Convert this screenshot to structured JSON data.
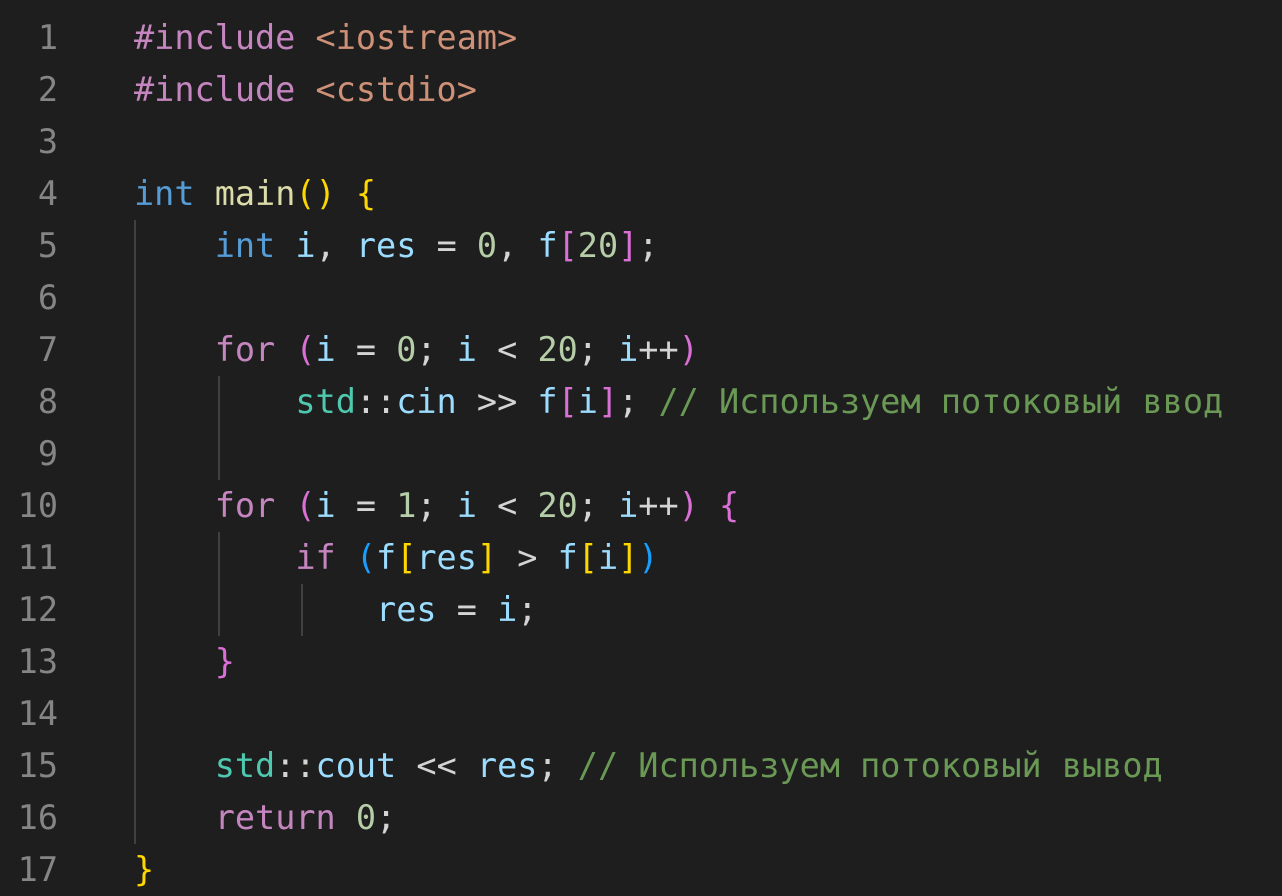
{
  "editor": {
    "colors": {
      "background": "#1e1e1e",
      "line_number": "#858585",
      "directive": "#c586c0",
      "header": "#ce9178",
      "keyword": "#569cd6",
      "control": "#c586c0",
      "function": "#dcdcaa",
      "variable": "#9cdcfe",
      "number": "#b5cea8",
      "namespace": "#4ec9b0",
      "comment": "#6a9955",
      "bracket_level1": "#ffd700",
      "bracket_level2": "#da70d6",
      "bracket_level3": "#179fff"
    },
    "lines": [
      {
        "num": "1",
        "tokens": [
          {
            "t": "#include",
            "c": "dir"
          },
          {
            "t": " ",
            "c": "plain"
          },
          {
            "t": "<iostream>",
            "c": "hdr"
          }
        ]
      },
      {
        "num": "2",
        "tokens": [
          {
            "t": "#include",
            "c": "dir"
          },
          {
            "t": " ",
            "c": "plain"
          },
          {
            "t": "<cstdio>",
            "c": "hdr"
          }
        ]
      },
      {
        "num": "3",
        "tokens": []
      },
      {
        "num": "4",
        "tokens": [
          {
            "t": "int",
            "c": "kw"
          },
          {
            "t": " ",
            "c": "plain"
          },
          {
            "t": "main",
            "c": "fn"
          },
          {
            "t": "()",
            "c": "b1"
          },
          {
            "t": " ",
            "c": "plain"
          },
          {
            "t": "{",
            "c": "b1"
          }
        ]
      },
      {
        "num": "5",
        "tokens": [
          {
            "t": "    ",
            "c": "plain"
          },
          {
            "t": "int",
            "c": "kw"
          },
          {
            "t": " ",
            "c": "plain"
          },
          {
            "t": "i",
            "c": "var"
          },
          {
            "t": ", ",
            "c": "op"
          },
          {
            "t": "res",
            "c": "var"
          },
          {
            "t": " = ",
            "c": "op"
          },
          {
            "t": "0",
            "c": "num"
          },
          {
            "t": ", ",
            "c": "op"
          },
          {
            "t": "f",
            "c": "var"
          },
          {
            "t": "[",
            "c": "b2"
          },
          {
            "t": "20",
            "c": "num"
          },
          {
            "t": "]",
            "c": "b2"
          },
          {
            "t": ";",
            "c": "op"
          }
        ]
      },
      {
        "num": "6",
        "tokens": []
      },
      {
        "num": "7",
        "tokens": [
          {
            "t": "    ",
            "c": "plain"
          },
          {
            "t": "for",
            "c": "ctrl"
          },
          {
            "t": " ",
            "c": "plain"
          },
          {
            "t": "(",
            "c": "b2"
          },
          {
            "t": "i",
            "c": "var"
          },
          {
            "t": " = ",
            "c": "op"
          },
          {
            "t": "0",
            "c": "num"
          },
          {
            "t": "; ",
            "c": "op"
          },
          {
            "t": "i",
            "c": "var"
          },
          {
            "t": " < ",
            "c": "op"
          },
          {
            "t": "20",
            "c": "num"
          },
          {
            "t": "; ",
            "c": "op"
          },
          {
            "t": "i",
            "c": "var"
          },
          {
            "t": "++",
            "c": "op"
          },
          {
            "t": ")",
            "c": "b2"
          }
        ]
      },
      {
        "num": "8",
        "tokens": [
          {
            "t": "        ",
            "c": "plain"
          },
          {
            "t": "std",
            "c": "ns"
          },
          {
            "t": "::",
            "c": "op"
          },
          {
            "t": "cin",
            "c": "var"
          },
          {
            "t": " >> ",
            "c": "op"
          },
          {
            "t": "f",
            "c": "var"
          },
          {
            "t": "[",
            "c": "b2"
          },
          {
            "t": "i",
            "c": "var"
          },
          {
            "t": "]",
            "c": "b2"
          },
          {
            "t": "; ",
            "c": "op"
          },
          {
            "t": "// Используем потоковый ввод",
            "c": "cmt"
          }
        ]
      },
      {
        "num": "9",
        "tokens": []
      },
      {
        "num": "10",
        "tokens": [
          {
            "t": "    ",
            "c": "plain"
          },
          {
            "t": "for",
            "c": "ctrl"
          },
          {
            "t": " ",
            "c": "plain"
          },
          {
            "t": "(",
            "c": "b2"
          },
          {
            "t": "i",
            "c": "var"
          },
          {
            "t": " = ",
            "c": "op"
          },
          {
            "t": "1",
            "c": "num"
          },
          {
            "t": "; ",
            "c": "op"
          },
          {
            "t": "i",
            "c": "var"
          },
          {
            "t": " < ",
            "c": "op"
          },
          {
            "t": "20",
            "c": "num"
          },
          {
            "t": "; ",
            "c": "op"
          },
          {
            "t": "i",
            "c": "var"
          },
          {
            "t": "++",
            "c": "op"
          },
          {
            "t": ")",
            "c": "b2"
          },
          {
            "t": " ",
            "c": "plain"
          },
          {
            "t": "{",
            "c": "b2"
          }
        ]
      },
      {
        "num": "11",
        "tokens": [
          {
            "t": "        ",
            "c": "plain"
          },
          {
            "t": "if",
            "c": "ctrl"
          },
          {
            "t": " ",
            "c": "plain"
          },
          {
            "t": "(",
            "c": "b3"
          },
          {
            "t": "f",
            "c": "var"
          },
          {
            "t": "[",
            "c": "b1"
          },
          {
            "t": "res",
            "c": "var"
          },
          {
            "t": "]",
            "c": "b1"
          },
          {
            "t": " > ",
            "c": "op"
          },
          {
            "t": "f",
            "c": "var"
          },
          {
            "t": "[",
            "c": "b1"
          },
          {
            "t": "i",
            "c": "var"
          },
          {
            "t": "]",
            "c": "b1"
          },
          {
            "t": ")",
            "c": "b3"
          }
        ]
      },
      {
        "num": "12",
        "tokens": [
          {
            "t": "            ",
            "c": "plain"
          },
          {
            "t": "res",
            "c": "var"
          },
          {
            "t": " = ",
            "c": "op"
          },
          {
            "t": "i",
            "c": "var"
          },
          {
            "t": ";",
            "c": "op"
          }
        ]
      },
      {
        "num": "13",
        "tokens": [
          {
            "t": "    ",
            "c": "plain"
          },
          {
            "t": "}",
            "c": "b2"
          }
        ]
      },
      {
        "num": "14",
        "tokens": []
      },
      {
        "num": "15",
        "tokens": [
          {
            "t": "    ",
            "c": "plain"
          },
          {
            "t": "std",
            "c": "ns"
          },
          {
            "t": "::",
            "c": "op"
          },
          {
            "t": "cout",
            "c": "var"
          },
          {
            "t": " << ",
            "c": "op"
          },
          {
            "t": "res",
            "c": "var"
          },
          {
            "t": "; ",
            "c": "op"
          },
          {
            "t": "// Используем потоковый вывод",
            "c": "cmt"
          }
        ]
      },
      {
        "num": "16",
        "tokens": [
          {
            "t": "    ",
            "c": "plain"
          },
          {
            "t": "return",
            "c": "ctrl"
          },
          {
            "t": " ",
            "c": "plain"
          },
          {
            "t": "0",
            "c": "num"
          },
          {
            "t": ";",
            "c": "op"
          }
        ]
      },
      {
        "num": "17",
        "tokens": [
          {
            "t": "}",
            "c": "b1"
          }
        ]
      }
    ]
  }
}
